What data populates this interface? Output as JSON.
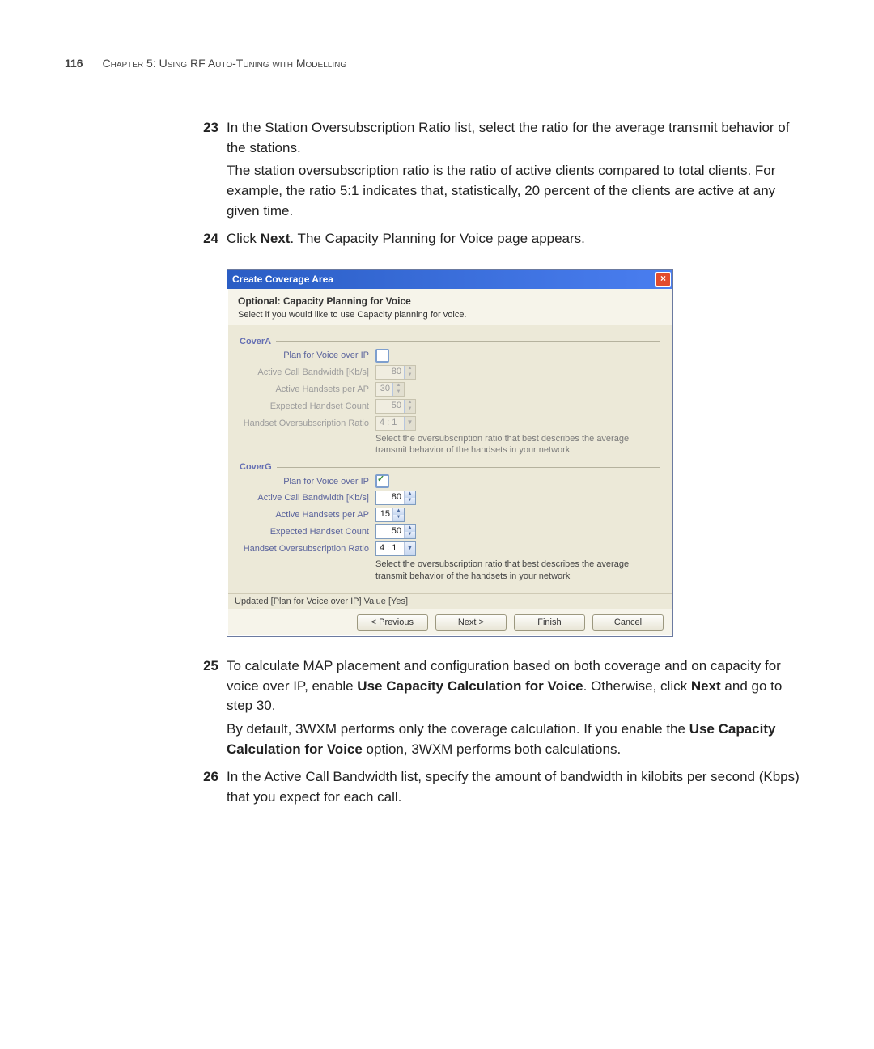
{
  "header": {
    "page_number": "116",
    "chapter": "Chapter 5: Using RF Auto-Tuning with Modelling"
  },
  "steps": {
    "s23": {
      "num": "23",
      "text": "In the Station Oversubscription Ratio list, select the ratio for the average transmit behavior of the stations.",
      "para": "The station oversubscription ratio is the ratio of active clients compared to total clients. For example, the ratio 5:1 indicates that, statistically, 20 percent of the clients are active at any given time."
    },
    "s24": {
      "num": "24",
      "text_pre": "Click ",
      "bold1": "Next",
      "text_post": ". The Capacity Planning for Voice page appears."
    },
    "s25": {
      "num": "25",
      "text_pre": "To calculate MAP placement and configuration based on both coverage and on capacity for voice over IP, enable ",
      "bold1": "Use Capacity Calculation for Voice",
      "mid": ". Otherwise, click ",
      "bold2": "Next",
      "text_post": " and go to step 30.",
      "para_pre": "By default, 3WXM performs only the coverage calculation. If you enable the ",
      "para_bold": "Use Capacity Calculation for Voice",
      "para_post": " option, 3WXM performs both calculations."
    },
    "s26": {
      "num": "26",
      "text": "In the Active Call Bandwidth list, specify the amount of bandwidth in kilobits per second (Kbps) that you expect for each call."
    }
  },
  "dialog": {
    "title": "Create Coverage Area",
    "heading": "Optional: Capacity Planning for Voice",
    "subheading": "Select if you would like to use Capacity planning for voice.",
    "labels": {
      "plan_voip": "Plan for Voice over IP",
      "active_bw": "Active Call Bandwidth [Kb/s]",
      "handsets_per_ap": "Active Handsets per AP",
      "handset_count": "Expected Handset Count",
      "oversub": "Handset Oversubscription Ratio"
    },
    "help": "Select the oversubscription ratio that best describes the average transmit behavior of the handsets in your network",
    "groupA": {
      "name": "CoverA",
      "plan_voip_checked": false,
      "active_bw": "80",
      "handsets_per_ap": "30",
      "handset_count": "50",
      "oversub": "4 : 1"
    },
    "groupG": {
      "name": "CoverG",
      "plan_voip_checked": true,
      "active_bw": "80",
      "handsets_per_ap": "15",
      "handset_count": "50",
      "oversub": "4 : 1"
    },
    "status": "Updated [Plan for Voice over IP] Value [Yes]",
    "buttons": {
      "prev": "< Previous",
      "next": "Next >",
      "finish": "Finish",
      "cancel": "Cancel"
    }
  }
}
